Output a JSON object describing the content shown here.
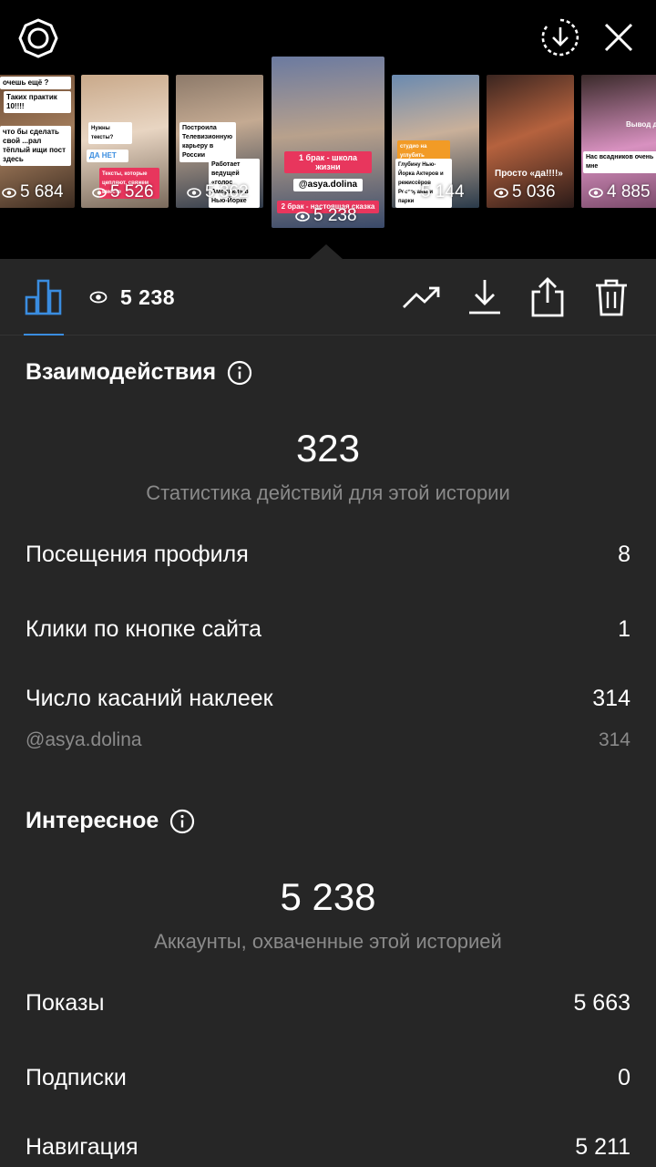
{
  "header": {
    "icons": [
      "settings-icon",
      "download-circle-icon",
      "close-icon"
    ]
  },
  "stories": [
    {
      "caption_top": "очешь ещё ?",
      "caption_mid": "Таких практик 10!!!!",
      "caption_bottom": "что бы сделать свой ...рал тёплый ищи пост здесь",
      "views": "5 684"
    },
    {
      "caption_top": "Нужны тексты?",
      "caption_mid": "ДА   НЕТ",
      "caption_bottom": "Тексты, которые цепляют, свяжем вместе",
      "views": "5 526"
    },
    {
      "caption_top": "Построила Телевизионную карьеру в России",
      "caption_mid": "",
      "caption_bottom": "Работает ведущей «голос Америки» в Нью-Йорке",
      "views": "5 362"
    },
    {
      "caption_top": "1 брак - школа жизни",
      "caption_mid": "@asya.dolina",
      "caption_bottom": "2 брак - настоящая сказка",
      "views": "5 238"
    },
    {
      "caption_top": "студио на углубить",
      "caption_mid": "Глубину Нью-Йорка Актеров и режиссёров Рестораны и парки",
      "caption_bottom": "",
      "views": "5 144"
    },
    {
      "caption_top": "",
      "caption_mid": "",
      "caption_bottom": "Просто «да!!!!»",
      "views": "5 036"
    },
    {
      "caption_top": "Вывод д",
      "caption_mid": "",
      "caption_bottom": "Нас всадников очень мне",
      "views": "4 885"
    }
  ],
  "toolbar": {
    "views": "5 238",
    "icons": [
      "bar-chart-icon",
      "eye-icon",
      "trend-icon",
      "download-icon",
      "share-icon",
      "trash-icon"
    ]
  },
  "interactions": {
    "title": "Взаимодействия",
    "total": "323",
    "subtitle": "Статистика действий для этой истории",
    "rows": [
      {
        "label": "Посещения профиля",
        "value": "8"
      },
      {
        "label": "Клики по кнопке сайта",
        "value": "1"
      },
      {
        "label": "Число касаний наклеек",
        "value": "314"
      }
    ],
    "sticker": {
      "label": "@asya.dolina",
      "value": "314"
    }
  },
  "discovery": {
    "title": "Интересное",
    "total": "5 238",
    "subtitle": "Аккаунты, охваченные этой историей",
    "rows": [
      {
        "label": "Показы",
        "value": "5 663"
      },
      {
        "label": "Подписки",
        "value": "0"
      },
      {
        "label": "Навигация",
        "value": "5 211"
      }
    ]
  },
  "colors": {
    "accent": "#3a8de0",
    "panel": "#262626",
    "muted": "#8a8a8a"
  }
}
